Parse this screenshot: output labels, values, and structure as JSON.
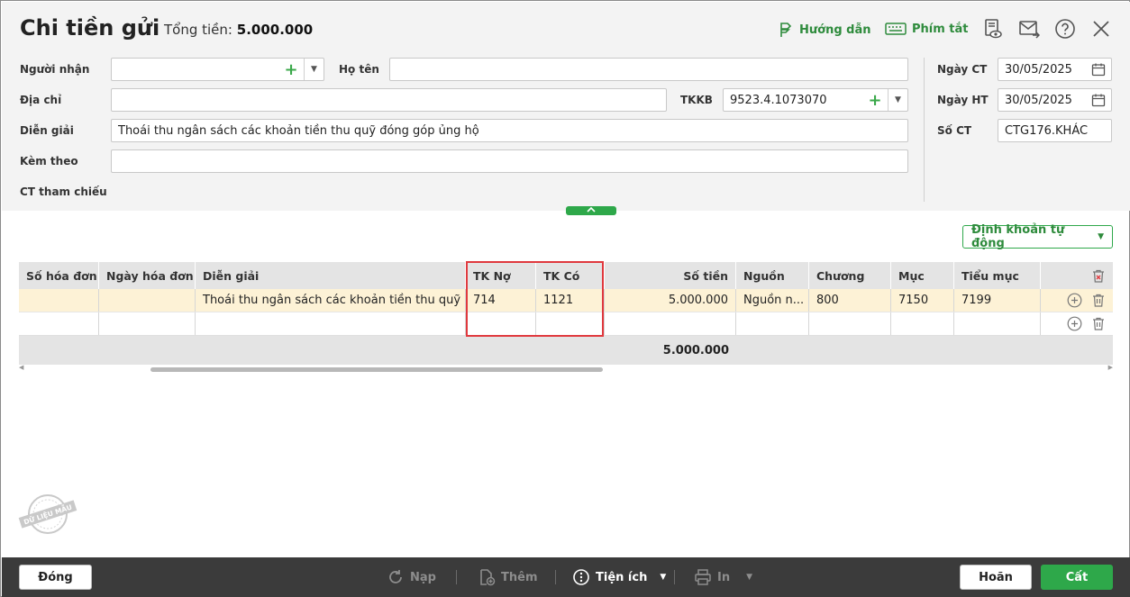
{
  "header": {
    "title": "Chi tiền gửi",
    "total_label": "Tổng tiền:",
    "total_value": "5.000.000",
    "help_label": "Hướng dẫn",
    "shortcut_label": "Phím tắt"
  },
  "form": {
    "recipient_label": "Người nhận",
    "recipient_value": "",
    "fullname_label": "Họ tên",
    "fullname_value": "",
    "address_label": "Địa chỉ",
    "address_value": "",
    "tkkb_label": "TKKB",
    "tkkb_value": "9523.4.1073070",
    "description_label": "Diễn giải",
    "description_value": "Thoái thu ngân sách các khoản tiền thu quỹ đóng góp ủng hộ",
    "attach_label": "Kèm theo",
    "attach_value": "",
    "ref_label": "CT tham chiếu",
    "doc_date_label": "Ngày CT",
    "doc_date_value": "30/05/2025",
    "acc_date_label": "Ngày HT",
    "acc_date_value": "30/05/2025",
    "doc_no_label": "Số CT",
    "doc_no_value": "CTG176.KHÁC"
  },
  "auto_posting_label": "Định khoản tự động",
  "grid": {
    "columns": [
      "Số hóa đơn",
      "Ngày hóa đơn",
      "Diễn giải",
      "TK Nợ",
      "TK Có",
      "Số tiền",
      "Nguồn",
      "Chương",
      "Mục",
      "Tiểu mục"
    ],
    "rows": [
      [
        "",
        "",
        "Thoái thu ngân sách các khoản tiền thu quỹ ...",
        "714",
        "1121",
        "5.000.000",
        "Nguồn n...",
        "800",
        "7150",
        "7199"
      ]
    ],
    "footer_total": "5.000.000"
  },
  "stamp_text": "DỮ LIỆU MẪU",
  "footer": {
    "close_label": "Đóng",
    "reload_label": "Nạp",
    "add_label": "Thêm",
    "utilities_label": "Tiện ích",
    "print_label": "In",
    "cancel_label": "Hoãn",
    "save_label": "Cất"
  },
  "colors": {
    "accent": "#2ea84a",
    "highlight": "#e0393e",
    "selected_row": "#fdf2d6",
    "footer_bg": "#3b3b3b"
  }
}
